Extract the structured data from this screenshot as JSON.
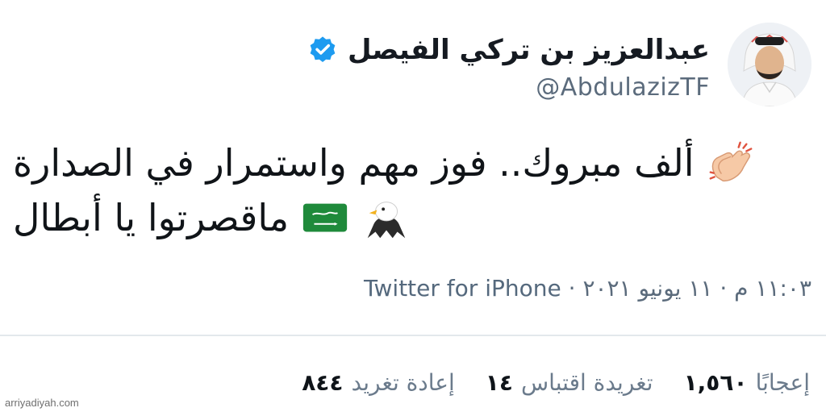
{
  "author": {
    "display_name": "عبدالعزيز بن تركي الفيصل",
    "handle": "@AbdulazizTF"
  },
  "tweet": {
    "line1": "ألف مبروك.. فوز مهم واستمرار في الصدارة",
    "line2": "ماقصرتوا يا أبطال",
    "emojis": [
      "clapping-hands-icon",
      "saudi-flag-icon",
      "eagle-icon"
    ]
  },
  "meta": {
    "time": "١١:٠٣ م",
    "date": "١١ يونيو ٢٠٢١",
    "separator": "·",
    "source": "Twitter for iPhone"
  },
  "stats": {
    "retweets_count": "٨٤٤",
    "retweets_label": "إعادة تغريد",
    "quotes_count": "١٤",
    "quotes_label": "تغريدة اقتباس",
    "likes_count": "١,٥٦٠",
    "likes_label": "إعجابًا"
  },
  "watermark": "arriyadiyah.com",
  "colors": {
    "verified": "#1d9bf0",
    "text": "#101418",
    "muted": "#5b6b7c",
    "divider": "#e3e8ec"
  }
}
